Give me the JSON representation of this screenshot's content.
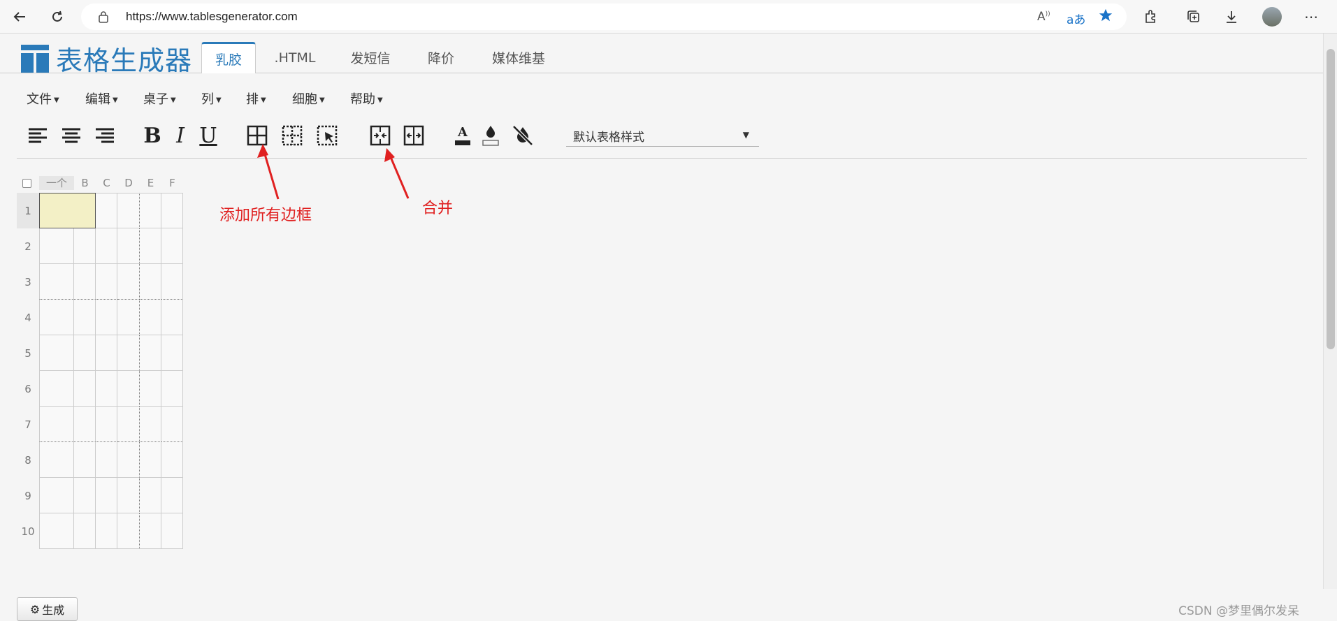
{
  "browser": {
    "url": "https://www.tablesgenerator.com"
  },
  "app": {
    "logo_text": "表格生成器",
    "tabs": [
      {
        "label": "乳胶",
        "active": true
      },
      {
        "label": ".HTML",
        "active": false
      },
      {
        "label": "发短信",
        "active": false
      },
      {
        "label": "降价",
        "active": false
      },
      {
        "label": "媒体维基",
        "active": false
      }
    ],
    "menus": [
      "文件",
      "编辑",
      "桌子",
      "列",
      "排",
      "细胞",
      "帮助"
    ],
    "table_style": "默认表格样式",
    "columns": [
      "一个",
      "B",
      "C",
      "D",
      "E",
      "F"
    ],
    "rows": [
      "1",
      "2",
      "3",
      "4",
      "5",
      "6",
      "7",
      "8",
      "9",
      "10"
    ],
    "generate_label": "生成"
  },
  "annotations": {
    "borders": "添加所有边框",
    "merge": "合并"
  },
  "watermark": "CSDN @梦里偶尔发呆",
  "colors": {
    "accent": "#2a7ab9",
    "annotation": "#e02020",
    "selected_cell": "#f3f0c6"
  }
}
